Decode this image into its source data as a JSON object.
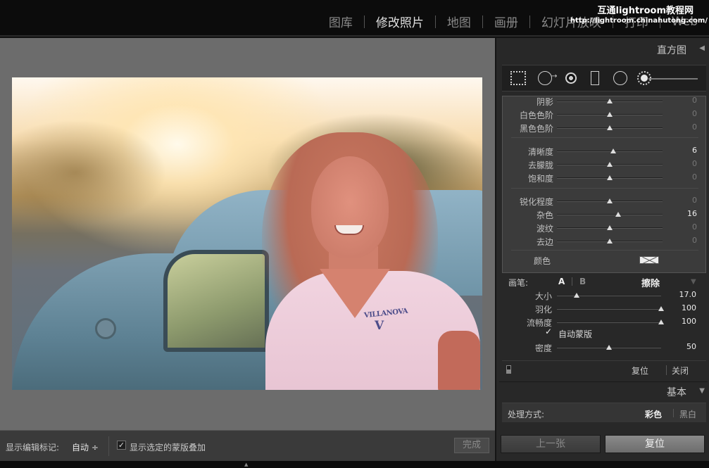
{
  "watermark": {
    "title": "互通lightroom教程网",
    "url": "http://lightroom.chinahutong.com/"
  },
  "modules": [
    "图库",
    "修改照片",
    "地图",
    "画册",
    "幻灯片放映",
    "打印",
    "Web"
  ],
  "active_module": "修改照片",
  "right_panel": {
    "histogram_title": "直方图",
    "sliders": [
      {
        "label": "阴影",
        "value": "0",
        "pos": 0.5,
        "changed": false
      },
      {
        "label": "白色色阶",
        "value": "0",
        "pos": 0.5,
        "changed": false
      },
      {
        "label": "黑色色阶",
        "value": "0",
        "pos": 0.5,
        "changed": false
      },
      {
        "label": "清晰度",
        "value": "6",
        "pos": 0.53,
        "changed": true
      },
      {
        "label": "去朦胧",
        "value": "0",
        "pos": 0.5,
        "changed": false
      },
      {
        "label": "饱和度",
        "value": "0",
        "pos": 0.5,
        "changed": false
      },
      {
        "label": "锐化程度",
        "value": "0",
        "pos": 0.5,
        "changed": false
      },
      {
        "label": "杂色",
        "value": "16",
        "pos": 0.58,
        "changed": true
      },
      {
        "label": "波纹",
        "value": "0",
        "pos": 0.5,
        "changed": false
      },
      {
        "label": "去边",
        "value": "0",
        "pos": 0.5,
        "changed": false
      }
    ],
    "color_label": "颜色",
    "brush": {
      "label": "画笔:",
      "a": "A",
      "b": "B",
      "erase": "擦除",
      "sliders": [
        {
          "label": "大小",
          "value": "17.0",
          "pos": 0.19
        },
        {
          "label": "羽化",
          "value": "100",
          "pos": 1.0
        },
        {
          "label": "流畅度",
          "value": "100",
          "pos": 1.0
        }
      ],
      "auto_mask": "自动蒙版",
      "density": {
        "label": "密度",
        "value": "50",
        "pos": 0.5
      }
    },
    "reset": "复位",
    "close": "关闭",
    "basic_title": "基本",
    "treatment": {
      "label": "处理方式:",
      "color": "彩色",
      "bw": "黑白"
    },
    "prev_button": "上一张",
    "reset_button": "复位"
  },
  "toolbar": {
    "show_edit_pins_label": "显示编辑标记:",
    "show_edit_pins_value": "自动 ÷",
    "show_mask_overlay_label": "显示选定的蒙版叠加",
    "done_button": "完成"
  },
  "photo": {
    "shirt_text": "VILLANOVA",
    "shirt_letter": "V"
  }
}
